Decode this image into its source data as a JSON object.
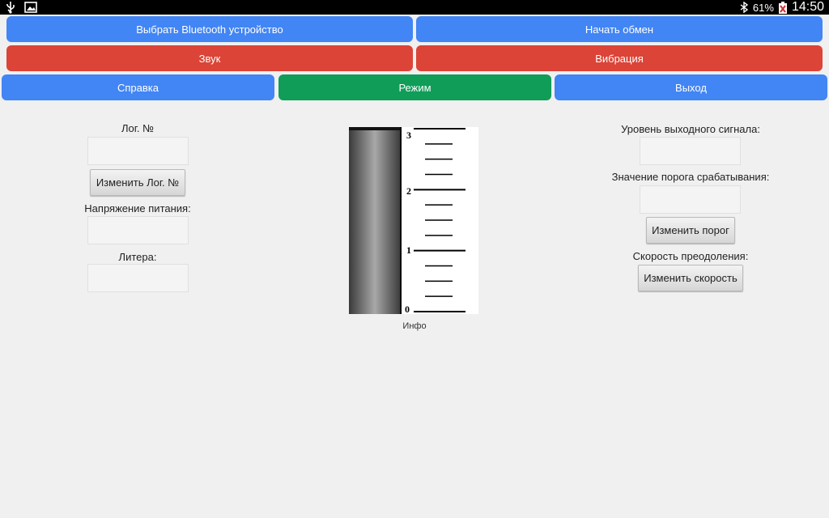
{
  "status": {
    "battery": "61%",
    "time": "14:50"
  },
  "buttons": {
    "select_bt": "Выбрать Bluetooth устройство",
    "start_exchange": "Начать обмен",
    "sound": "Звук",
    "vibration": "Вибрация",
    "help": "Справка",
    "mode": "Режим",
    "exit": "Выход"
  },
  "left": {
    "log_label": "Лог. №",
    "change_log": "Изменить Лог. №",
    "voltage_label": "Напряжение питания:",
    "litera_label": "Литера:"
  },
  "right": {
    "output_level_label": "Уровень выходного сигнала:",
    "threshold_label": "Значение порога срабатывания:",
    "change_threshold": "Изменить порог",
    "speed_label": "Скорость преодоления:",
    "change_speed": "Изменить скорость"
  },
  "gauge": {
    "tick_labels": [
      "3",
      "2",
      "1",
      "0"
    ],
    "min": 0,
    "max": 3,
    "info_label": "Инфо"
  },
  "colors": {
    "blue": "#4285f4",
    "red": "#db4437",
    "green": "#0f9d58"
  }
}
